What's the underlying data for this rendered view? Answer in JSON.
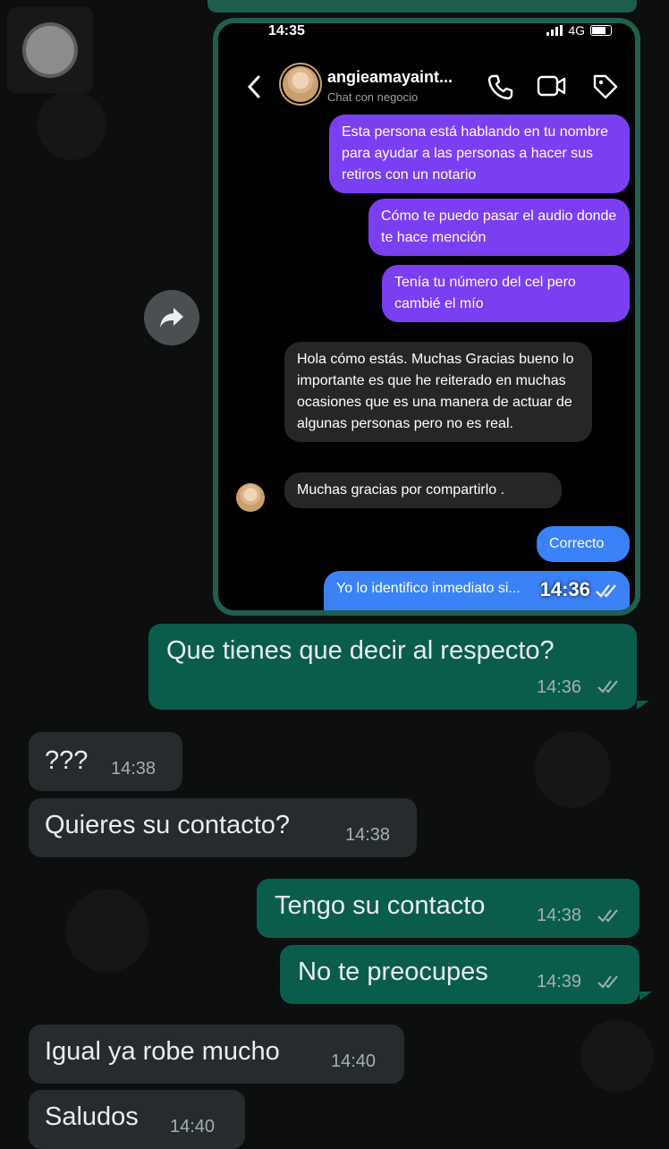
{
  "embedded_screenshot": {
    "status_time": "14:35",
    "network": "4G",
    "header": {
      "name": "angieamayaint...",
      "subtitle": "Chat con negocio"
    },
    "messages": [
      {
        "text": "Esta persona está hablando en tu nombre para ayudar a las personas a hacer sus retiros con un notario",
        "side": "sent"
      },
      {
        "text": "Cómo te puedo pasar el audio donde te hace mención",
        "side": "sent"
      },
      {
        "text": "Tenía tu número del cel pero cambié el mío",
        "side": "sent"
      },
      {
        "text": "Hola cómo estás. Muchas Gracias bueno lo importante es que he reiterado en muchas ocasiones que es una manera de actuar de algunas personas pero no es real.",
        "side": "received"
      },
      {
        "text": "Muchas gracias por compartirlo .",
        "side": "received"
      },
      {
        "text": "Correcto",
        "side": "sent"
      },
      {
        "text": "Yo lo identifico inmediato si...",
        "side": "sent"
      }
    ],
    "forward_time": "14:36"
  },
  "chat": [
    {
      "text": "Que tienes que decir al respecto?",
      "time": "14:36",
      "side": "out"
    },
    {
      "text": "???",
      "time": "14:38",
      "side": "in"
    },
    {
      "text": "Quieres su contacto?",
      "time": "14:38",
      "side": "in"
    },
    {
      "text": "Tengo su contacto",
      "time": "14:38",
      "side": "out"
    },
    {
      "text": "No te preocupes",
      "time": "14:39",
      "side": "out"
    },
    {
      "text": "Igual ya robe mucho",
      "time": "14:40",
      "side": "in"
    },
    {
      "text": "Saludos",
      "time": "14:40",
      "side": "in"
    }
  ],
  "colors": {
    "outgoing_bubble": "#0b5d4b",
    "incoming_bubble": "#262b2e",
    "instagram_sent": "#7b3ff2",
    "instagram_blue": "#3b82f6"
  }
}
